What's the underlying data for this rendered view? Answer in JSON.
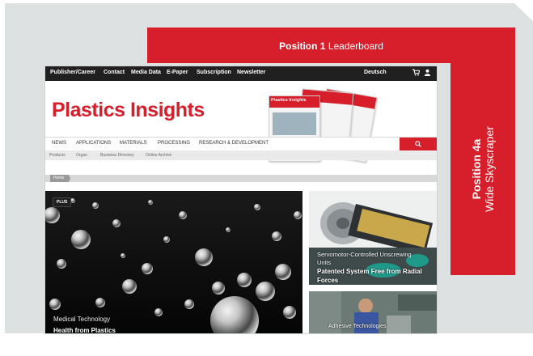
{
  "leaderboard": {
    "position": "Position 1",
    "name": "Leaderboard"
  },
  "skyscraper": {
    "position": "Position 4a",
    "name": "Wide Skyscraper"
  },
  "site": {
    "top_nav": [
      "Publisher/Career",
      "Contact",
      "Media Data",
      "E-Paper",
      "Subscription",
      "Newsletter"
    ],
    "language": "Deutsch",
    "logo": "Plastics Insights",
    "magazine_label": "Plastics Insights",
    "main_nav": [
      "NEWS",
      "APPLICATIONS",
      "MATERIALS",
      "PROCESSING",
      "RESEARCH & DEVELOPMENT"
    ],
    "sub_nav": [
      "Products",
      "Organ",
      "Business Directory",
      "Online Archive"
    ],
    "breadcrumb": "Home",
    "hero": {
      "badge": "PLUS",
      "category": "Medical Technology",
      "headline": "Health from Plastics"
    },
    "card1": {
      "category": "Servomotor-Controlled Unscrewing",
      "sub": "Units",
      "headline": "Patented System Free from Radial Forces"
    },
    "card2": {
      "category": "Adhesive Technologies"
    }
  },
  "colors": {
    "accent": "#d61f2b",
    "panel": "#dde1e2",
    "nav": "#202020"
  },
  "icons": [
    "cart-icon",
    "user-icon",
    "search-icon"
  ]
}
